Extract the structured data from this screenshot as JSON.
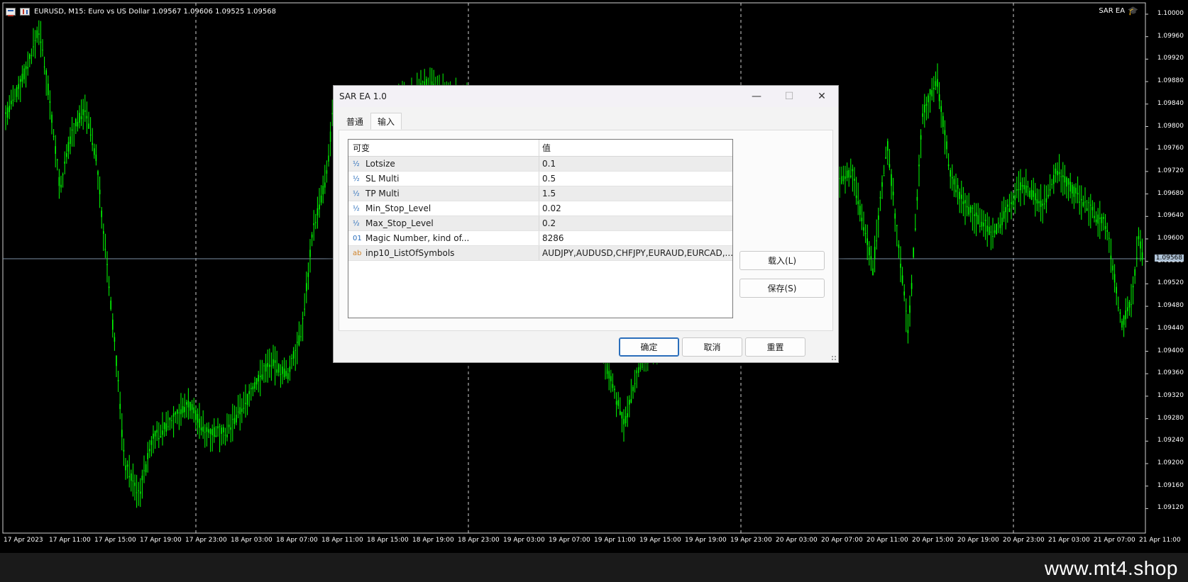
{
  "chart": {
    "symbol_header": "EURUSD, M15:  Euro vs US Dollar  1.09567 1.09606 1.09525 1.09568",
    "ea_label": "SAR EA",
    "candle_color": "#00ff00",
    "background": "#000000",
    "current_price": "1.09568",
    "price_labels": [
      "1.10000",
      "1.09960",
      "1.09920",
      "1.09880",
      "1.09840",
      "1.09800",
      "1.09760",
      "1.09720",
      "1.09680",
      "1.09640",
      "1.09600",
      "1.09560",
      "1.09520",
      "1.09480",
      "1.09440",
      "1.09400",
      "1.09360",
      "1.09320",
      "1.09280",
      "1.09240",
      "1.09200",
      "1.09160",
      "1.09120"
    ],
    "time_labels": [
      "17 Apr 2023",
      "17 Apr 11:00",
      "17 Apr 15:00",
      "17 Apr 19:00",
      "17 Apr 23:00",
      "18 Apr 03:00",
      "18 Apr 07:00",
      "18 Apr 11:00",
      "18 Apr 15:00",
      "18 Apr 19:00",
      "18 Apr 23:00",
      "19 Apr 03:00",
      "19 Apr 07:00",
      "19 Apr 11:00",
      "19 Apr 15:00",
      "19 Apr 19:00",
      "19 Apr 23:00",
      "20 Apr 03:00",
      "20 Apr 07:00",
      "20 Apr 11:00",
      "20 Apr 15:00",
      "20 Apr 19:00",
      "20 Apr 23:00",
      "21 Apr 03:00",
      "21 Apr 07:00",
      "21 Apr 11:00"
    ]
  },
  "dialog": {
    "title": "SAR EA 1.0",
    "tabs": [
      {
        "label": "普通",
        "active": false
      },
      {
        "label": "输入",
        "active": true
      }
    ],
    "table": {
      "header_name": "可变",
      "header_value": "值",
      "rows": [
        {
          "type": "½",
          "name": "Lotsize",
          "value": "0.1"
        },
        {
          "type": "½",
          "name": "SL Multi",
          "value": "0.5"
        },
        {
          "type": "½",
          "name": "TP Multi",
          "value": "1.5"
        },
        {
          "type": "½",
          "name": "Min_Stop_Level",
          "value": "0.02"
        },
        {
          "type": "½",
          "name": "Max_Stop_Level",
          "value": "0.2"
        },
        {
          "type": "01",
          "name": "Magic Number, kind of...",
          "value": "8286"
        },
        {
          "type": "ab",
          "name": "inp10_ListOfSymbols",
          "value": "AUDJPY,AUDUSD,CHFJPY,EURAUD,EURCAD,..."
        }
      ]
    },
    "load_button": "载入(L)",
    "save_button": "保存(S)",
    "ok_button": "确定",
    "cancel_button": "取消",
    "reset_button": "重置"
  },
  "footer": {
    "watermark": "www.mt4.shop"
  }
}
